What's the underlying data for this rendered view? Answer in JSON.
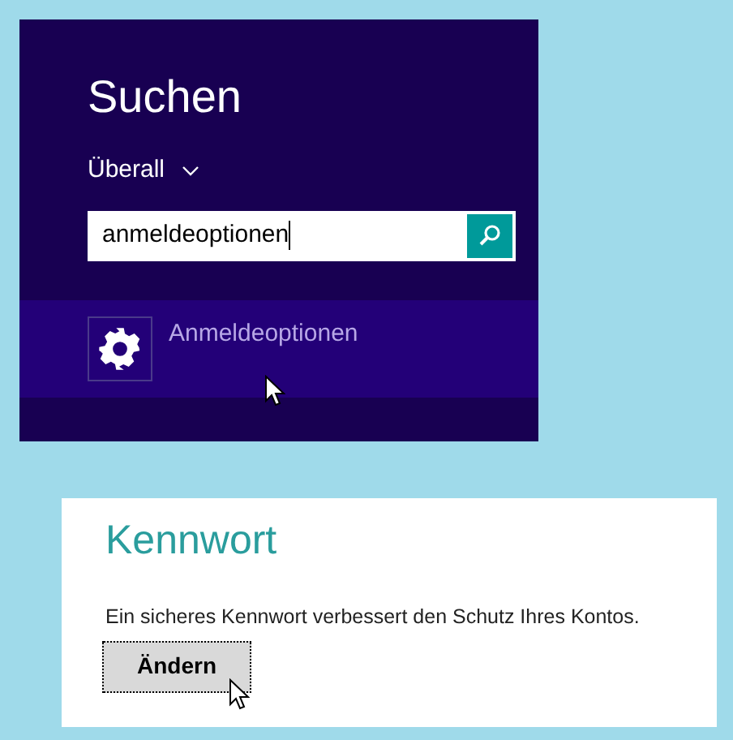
{
  "search_panel": {
    "title": "Suchen",
    "scope": "Überall",
    "query": "anmeldeoptionen",
    "results": [
      {
        "label": "Anmeldeoptionen",
        "selected": true
      }
    ]
  },
  "password_section": {
    "title": "Kennwort",
    "description": "Ein sicheres Kennwort verbessert den Schutz Ihres Kontos.",
    "button": {
      "label": "Ändern",
      "focused": true
    }
  }
}
